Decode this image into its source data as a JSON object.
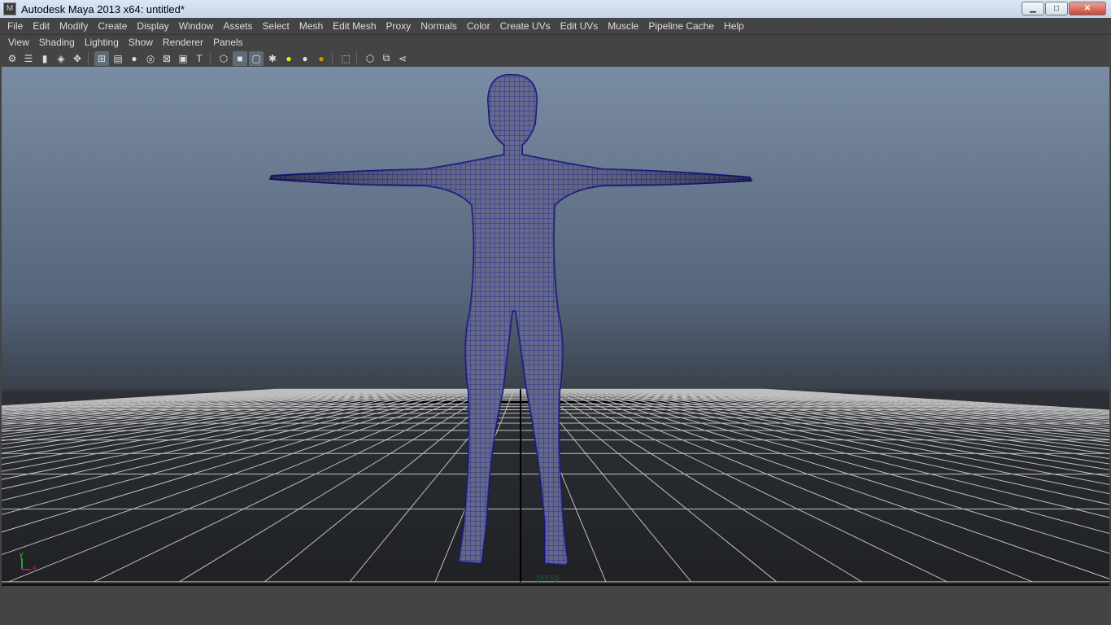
{
  "window": {
    "title": "Autodesk Maya 2013 x64: untitled*",
    "minimize": "▁",
    "maximize": "□",
    "close": "✕"
  },
  "menubar": [
    "File",
    "Edit",
    "Modify",
    "Create",
    "Display",
    "Window",
    "Assets",
    "Select",
    "Mesh",
    "Edit Mesh",
    "Proxy",
    "Normals",
    "Color",
    "Create UVs",
    "Edit UVs",
    "Muscle",
    "Pipeline Cache",
    "Help"
  ],
  "panel_menu": [
    "View",
    "Shading",
    "Lighting",
    "Show",
    "Renderer",
    "Panels"
  ],
  "toolbar": [
    {
      "icon": "select-camera-icon",
      "glyph": "⚙"
    },
    {
      "icon": "camera-attributes-icon",
      "glyph": "☰"
    },
    {
      "icon": "bookmark-icon",
      "glyph": "▮"
    },
    {
      "icon": "image-plane-icon",
      "glyph": "◈"
    },
    {
      "icon": "2d-pan-zoom-icon",
      "glyph": "✥"
    },
    {
      "sep": true
    },
    {
      "icon": "grid-icon",
      "glyph": "⊞",
      "active": true
    },
    {
      "icon": "film-gate-icon",
      "glyph": "▤"
    },
    {
      "icon": "resolution-gate-icon",
      "glyph": "●"
    },
    {
      "icon": "gate-mask-icon",
      "glyph": "◎"
    },
    {
      "icon": "field-chart-icon",
      "glyph": "⊠"
    },
    {
      "icon": "safe-action-icon",
      "glyph": "▣"
    },
    {
      "icon": "safe-title-icon",
      "glyph": "T"
    },
    {
      "sep": true
    },
    {
      "icon": "wireframe-icon",
      "glyph": "⬡"
    },
    {
      "icon": "smooth-shade-icon",
      "glyph": "■",
      "active": true
    },
    {
      "icon": "wireframe-on-shaded-icon",
      "glyph": "▢",
      "active": true
    },
    {
      "icon": "textured-icon",
      "glyph": "✱"
    },
    {
      "icon": "use-all-lights-icon",
      "glyph": "●"
    },
    {
      "icon": "shadows-icon",
      "glyph": "●"
    },
    {
      "icon": "high-quality-icon",
      "glyph": "●"
    },
    {
      "sep": true
    },
    {
      "icon": "isolate-select-icon",
      "glyph": "⬚"
    },
    {
      "sep": true
    },
    {
      "icon": "xray-icon",
      "glyph": "⬡"
    },
    {
      "icon": "xray-joints-icon",
      "glyph": "⧉"
    },
    {
      "icon": "share-icon",
      "glyph": "⋖"
    }
  ],
  "viewport": {
    "camera_label": "persp",
    "axis_y": "y",
    "axis_x": "x"
  },
  "colors": {
    "mesh": "#14157a",
    "sky_top": "#7a8ca3",
    "floor": "#1f2124",
    "grid": "#bfbfbf"
  }
}
